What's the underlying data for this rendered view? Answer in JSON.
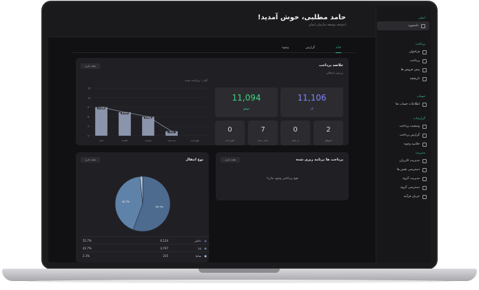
{
  "header": {
    "title": "حامد مطلبی، خوش آمدید!",
    "subtitle": "اندوخته توسعه سازمان ایمان"
  },
  "sidebar": {
    "groups": [
      {
        "head": "اصلی",
        "items": [
          {
            "label": "داشبورد",
            "icon": "grid-icon",
            "active": true
          }
        ]
      },
      {
        "head": "پرداخت",
        "items": [
          {
            "label": "فراخوان",
            "icon": "card-icon"
          },
          {
            "label": "پرداخت",
            "icon": "monitor-icon"
          },
          {
            "label": "پیش فروش ها",
            "icon": "inbox-icon"
          },
          {
            "label": "تاریخچه",
            "icon": "history-icon"
          }
        ]
      },
      {
        "head": "حساب",
        "items": [
          {
            "label": "اطلاعات حساب ها",
            "icon": "book-icon"
          }
        ]
      },
      {
        "head": "گزارشات",
        "items": [
          {
            "label": "وضعیت پرداخت",
            "icon": "chart-icon"
          },
          {
            "label": "گزارش پرداخت",
            "icon": "report-icon"
          },
          {
            "label": "خلاصه وجوه",
            "icon": "summary-icon"
          }
        ]
      },
      {
        "head": "مدیریت",
        "items": [
          {
            "label": "مدیریت کاربران",
            "icon": "users-icon"
          },
          {
            "label": "دسترسی نقش ها",
            "icon": "key-icon"
          },
          {
            "label": "مدیریت گروه",
            "icon": "group-icon"
          },
          {
            "label": "دسترسی گروه",
            "icon": "access-icon"
          },
          {
            "label": "جریان فرآیند",
            "icon": "flow-icon"
          }
        ]
      }
    ]
  },
  "tabs": [
    "خانه",
    "گزارش",
    "وجوه"
  ],
  "summary_card": {
    "title": "خلاصه پرداخت",
    "subtitle": "بررسی اجمالی",
    "filter": "هفته جاری",
    "chart_caption": "آمار ۱ پرداخت شده",
    "stats": [
      {
        "value": "11,106",
        "label": "کل",
        "color": "#7f86ff"
      },
      {
        "value": "11,094",
        "label": "موفق",
        "color": "#3fd67e"
      }
    ],
    "mini": [
      {
        "value": "2",
        "label": "ناموفق"
      },
      {
        "value": "0",
        "label": "در صف"
      },
      {
        "value": "7",
        "label": "حذف شده"
      },
      {
        "value": "0",
        "label": "لغو شده"
      }
    ]
  },
  "chart_data": {
    "type": "bar",
    "categories": [
      "شنبه",
      "یکشنبه",
      "دوشنبه",
      "سه شنبه",
      "چهارشنبه"
    ],
    "values": [
      9000,
      7400,
      6000,
      1400
    ],
    "value_labels": [
      "9,282",
      "8,057",
      "6,463",
      "976"
    ],
    "ylim": [
      0,
      15
    ],
    "ticks": [
      "0",
      "3",
      "6",
      "9",
      "12",
      "15"
    ],
    "line": true,
    "bar_color": "#8a94ab",
    "line_color": "#9aa3b8"
  },
  "pay_card": {
    "title": "پرداخت ها برنامه ریزی شده",
    "filter": "هفته جاری",
    "empty": "هیچ پرداختی وجود ندارد!"
  },
  "transfer_card": {
    "title": "نوع انتقال",
    "filter": "هفته جاری",
    "pie": [
      {
        "name": "داخلی",
        "value": 55.7,
        "color": "#4d6a8f"
      },
      {
        "name": "پایا",
        "value": 42.7,
        "color": "#5f82a8"
      },
      {
        "name": "ساتنا",
        "value": 1.6,
        "color": "#a9c6e6"
      }
    ],
    "pie_labels": [
      "55.7%",
      "42.7%"
    ],
    "rows": [
      {
        "name": "داخلی",
        "count": "6,124",
        "pct": "55.7%"
      },
      {
        "name": "پایا",
        "count": "4,747",
        "pct": "42.7%"
      },
      {
        "name": "ساتنا",
        "count": "235",
        "pct": "2.1%"
      }
    ]
  }
}
